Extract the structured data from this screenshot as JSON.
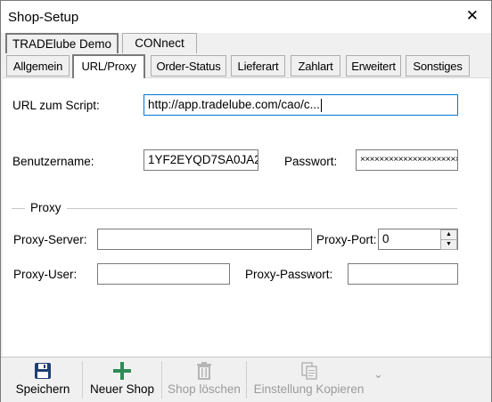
{
  "window": {
    "title": "Shop-Setup",
    "close_glyph": "✕"
  },
  "shop_tabs": [
    {
      "label": "TRADElube Demo",
      "active": true
    },
    {
      "label": "CONnect",
      "active": false
    }
  ],
  "section_tabs": [
    {
      "label": "Allgemein"
    },
    {
      "label": "URL/Proxy",
      "active": true
    },
    {
      "label": "Order-Status"
    },
    {
      "label": "Lieferart"
    },
    {
      "label": "Zahlart"
    },
    {
      "label": "Erweitert"
    },
    {
      "label": "Sonstiges"
    }
  ],
  "form": {
    "url_label": "URL zum Script:",
    "url_value": "http://app.tradelube.com/cao/c...",
    "user_label": "Benutzername:",
    "user_value": "1YF2EYQD7SA0JA2",
    "pass_label": "Passwort:",
    "pass_value": "××××××××××××××××××××××"
  },
  "proxy": {
    "group_title": "Proxy",
    "server_label": "Proxy-Server:",
    "server_value": "",
    "port_label": "Proxy-Port:",
    "port_value": "0",
    "user_label": "Proxy-User:",
    "user_value": "",
    "pass_label": "Proxy-Passwort:",
    "pass_value": ""
  },
  "toolbar": {
    "save_label": "Speichern",
    "new_label": "Neuer Shop",
    "delete_label": "Shop löschen",
    "copy_label": "Einstellung Kopieren",
    "more_glyph": "⌄"
  },
  "colors": {
    "save_icon": "#1f3f73",
    "new_icon": "#2e8b57",
    "disabled": "#9b9b9b",
    "focus_border": "#0078d7"
  }
}
